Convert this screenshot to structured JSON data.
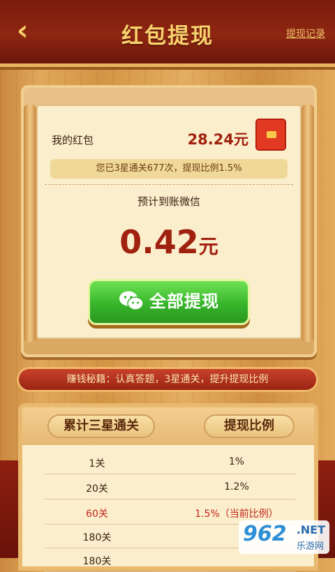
{
  "header": {
    "back_icon": "chevron-left-icon",
    "title": "红包提现",
    "record_link": "提现记录"
  },
  "wallet": {
    "label": "我的红包",
    "amount": "28.24元",
    "icon": "red-envelope-icon",
    "info": "您已3星通关677次，提现比例1.5%",
    "expect_label": "预计到账微信",
    "withdraw_value": "0.42",
    "withdraw_unit": "元",
    "withdraw_button": "全部提现",
    "wechat_icon": "wechat-icon"
  },
  "tip": "赚钱秘籍：认真答题，3星通关，提升提现比例",
  "table": {
    "headers": [
      "累计三星通关",
      "提现比例"
    ],
    "rows": [
      {
        "level": "1关",
        "ratio": "1%"
      },
      {
        "level": "20关",
        "ratio": "1.2%"
      },
      {
        "level": "60关",
        "ratio": "1.5%（当前比例）"
      },
      {
        "level": "180关",
        "ratio": ""
      },
      {
        "level": "180关",
        "ratio": ""
      }
    ]
  },
  "watermark": {
    "brand": "962",
    "suffix": ".NET",
    "sub": "乐游网"
  },
  "colors": {
    "accent": "#a0210f",
    "button_green": "#38b52b",
    "header": "#7a1c0c"
  }
}
